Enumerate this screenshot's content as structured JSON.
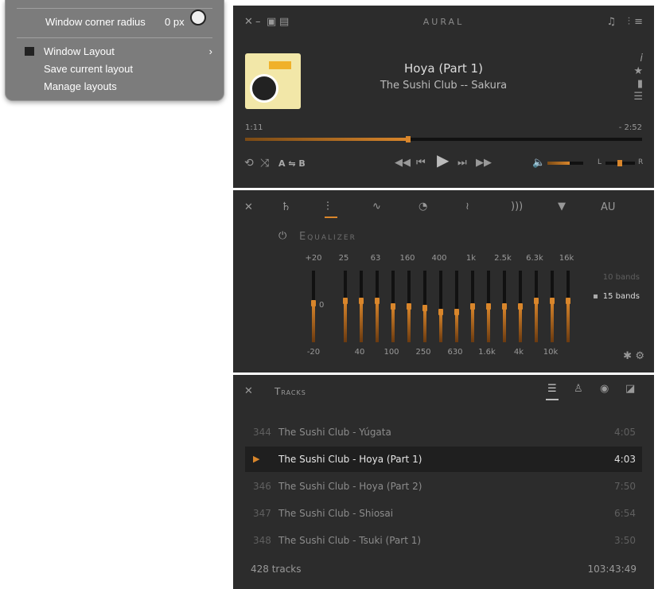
{
  "menu": {
    "corner_radius_label": "Window corner radius",
    "corner_radius_value": "0 px",
    "window_layout": "Window Layout",
    "save_layout": "Save current layout",
    "manage_layouts": "Manage layouts"
  },
  "player": {
    "app_name": "AURAL",
    "track_title": "Hoya (Part 1)",
    "track_subtitle": "The Sushi Club -- Sakura",
    "elapsed": "1:11",
    "remaining": "- 2:52",
    "progress": 0.41,
    "ab_label": "A ⇋ B",
    "volume": 0.62,
    "balance_left": "L",
    "balance_right": "R"
  },
  "equalizer": {
    "title": "Equalizer",
    "tab_au": "AU",
    "top_labels": [
      "+20",
      "25",
      "63",
      "160",
      "400",
      "1k",
      "2.5k",
      "6.3k",
      "16k"
    ],
    "bottom_labels": [
      "-20",
      "40",
      "100",
      "250",
      "630",
      "1.6k",
      "4k",
      "10k"
    ],
    "zero_label": "0",
    "band_option_10": "10 bands",
    "band_option_15": "15 bands",
    "selected_band_option": "15 bands",
    "preamp_level": 0.1,
    "band_levels": [
      0.15,
      0.15,
      0.15,
      0.0,
      0.0,
      -0.05,
      -0.15,
      -0.15,
      0.0,
      0.0,
      0.0,
      0.0,
      0.15,
      0.15,
      0.15
    ]
  },
  "tracks": {
    "title": "Tracks",
    "rows": [
      {
        "num": "344",
        "name": "The Sushi Club - Yúgata",
        "dur": "4:05"
      },
      {
        "num": "",
        "name": "The Sushi Club - Hoya (Part 1)",
        "dur": "4:03"
      },
      {
        "num": "346",
        "name": "The Sushi Club - Hoya (Part 2)",
        "dur": "7:50"
      },
      {
        "num": "347",
        "name": "The Sushi Club - Shiosai",
        "dur": "6:54"
      },
      {
        "num": "348",
        "name": "The Sushi Club - Tsuki (Part 1)",
        "dur": "3:50"
      }
    ],
    "count": "428 tracks",
    "total_duration": "103:43:49"
  },
  "colors": {
    "accent": "#d9862b",
    "panel_bg": "#2c2c2c",
    "menu_bg": "#7c7c7c"
  }
}
